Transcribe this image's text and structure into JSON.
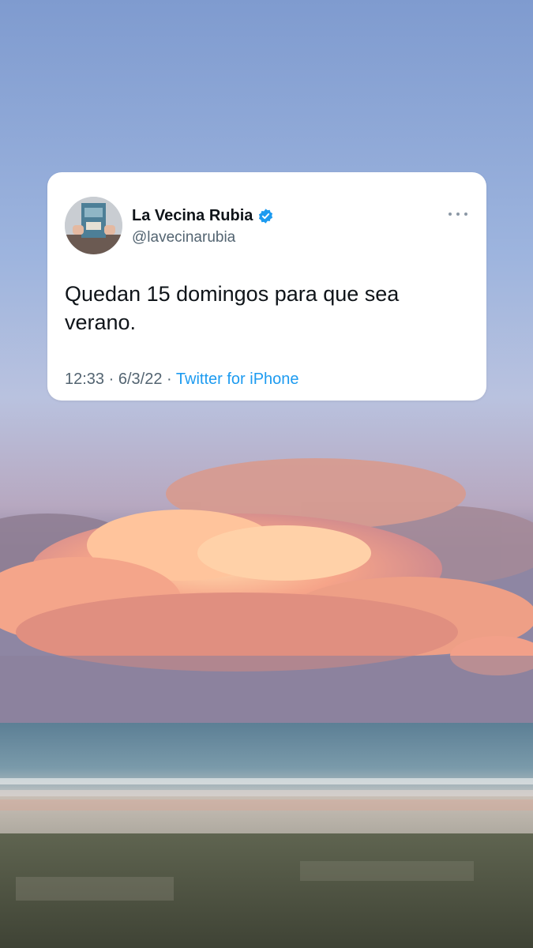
{
  "tweet": {
    "display_name": "La Vecina Rubia",
    "handle": "@lavecinarubia",
    "text": "Quedan 15 domingos para que sea verano.",
    "time": "12:33",
    "separator": "·",
    "date": "6/3/22",
    "source": "Twitter for iPhone",
    "verified": true
  },
  "icons": {
    "verified": "verified-badge-icon",
    "more": "more-options-icon"
  },
  "colors": {
    "card_background": "#ffffff",
    "name_text": "#0f1419",
    "secondary_text": "#536471",
    "link_blue": "#1d9bf0",
    "verified_blue": "#1d9bf0"
  }
}
